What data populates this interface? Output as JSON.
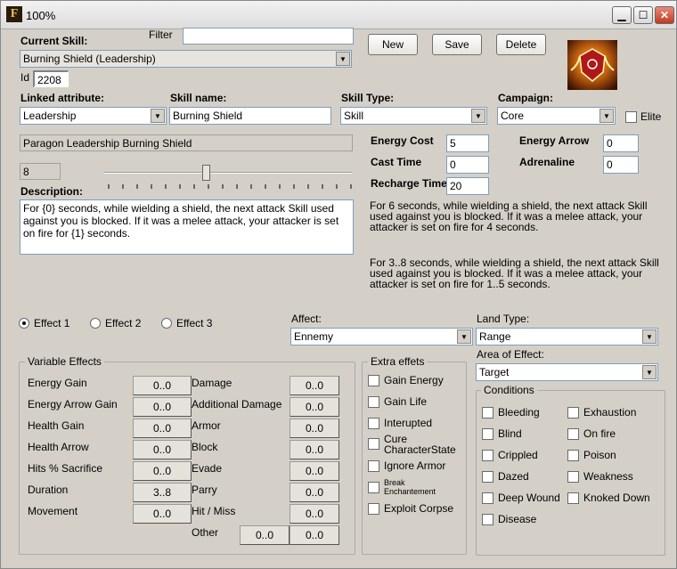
{
  "window": {
    "title": "100%",
    "app_icon": "F"
  },
  "top": {
    "current_skill_label": "Current Skill:",
    "filter_label": "Filter",
    "filter_value": "",
    "current_skill_value": "Burning Shield (Leadership)",
    "id_label": "Id",
    "id_value": "2208",
    "new_button": "New",
    "save_button": "Save",
    "delete_button": "Delete"
  },
  "fields": {
    "linked_attribute_label": "Linked attribute:",
    "linked_attribute_value": "Leadership",
    "skill_name_label": "Skill name:",
    "skill_name_value": "Burning Shield",
    "skill_type_label": "Skill Type:",
    "skill_type_value": "Skill",
    "campaign_label": "Campaign:",
    "campaign_value": "Core",
    "elite_label": "Elite",
    "full_name": "Paragon Leadership Burning Shield",
    "attr_level": "8",
    "description_label": "Description:",
    "description_value": "For {0} seconds, while wielding a shield, the next attack Skill used against you is blocked. If it was a melee attack, your attacker is set on fire for {1} seconds."
  },
  "costs": {
    "energy_cost_label": "Energy Cost",
    "energy_cost_value": "5",
    "cast_time_label": "Cast Time",
    "cast_time_value": "0",
    "recharge_time_label": "Recharge Time",
    "recharge_time_value": "20",
    "energy_arrow_label": "Energy Arrow",
    "energy_arrow_value": "0",
    "adrenaline_label": "Adrenaline",
    "adrenaline_value": "0"
  },
  "previews": {
    "preview_1": "For 6 seconds, while wielding a shield, the next attack Skill used against you is blocked. If it was a melee attack, your attacker is set on fire for 4 seconds.",
    "preview_2": "For 3..8 seconds, while wielding a shield, the next attack Skill used against you is blocked. If it was a melee attack, your attacker is set on fire for 1..5 seconds."
  },
  "effects": {
    "effect_1": "Effect 1",
    "effect_2": "Effect 2",
    "effect_3": "Effect 3",
    "affect_label": "Affect:",
    "affect_value": "Ennemy",
    "land_type_label": "Land Type:",
    "land_type_value": "Range",
    "area_label": "Area of Effect:",
    "area_value": "Target"
  },
  "variable_effects": {
    "title": "Variable Effects",
    "left": [
      {
        "label": "Energy Gain",
        "value": "0..0"
      },
      {
        "label": "Energy Arrow Gain",
        "value": "0..0"
      },
      {
        "label": "Health Gain",
        "value": "0..0"
      },
      {
        "label": "Health Arrow",
        "value": "0..0"
      },
      {
        "label": "Hits % Sacrifice",
        "value": "0..0"
      },
      {
        "label": "Duration",
        "value": "3..8"
      },
      {
        "label": "Movement",
        "value": "0..0"
      }
    ],
    "right": [
      {
        "label": "Damage",
        "value": "0..0"
      },
      {
        "label": "Additional Damage",
        "value": "0..0"
      },
      {
        "label": "Armor",
        "value": "0..0"
      },
      {
        "label": "Block",
        "value": "0..0"
      },
      {
        "label": "Evade",
        "value": "0..0"
      },
      {
        "label": "Parry",
        "value": "0..0"
      },
      {
        "label": "Hit / Miss",
        "value": "0..0"
      }
    ],
    "other_label": "Other",
    "other_value_1": "0..0",
    "other_value_2": "0..0"
  },
  "extra_effects": {
    "title": "Extra effets",
    "items": [
      "Gain Energy",
      "Gain Life",
      "Interupted",
      "Cure CharacterState",
      "Ignore Armor",
      "Break Enchantement",
      "Exploit Corpse"
    ]
  },
  "conditions": {
    "title": "Conditions",
    "left": [
      "Bleeding",
      "Blind",
      "Crippled",
      "Dazed",
      "Deep Wound",
      "Disease"
    ],
    "right": [
      "Exhaustion",
      "On fire",
      "Poison",
      "Weakness",
      "Knoked Down"
    ]
  }
}
